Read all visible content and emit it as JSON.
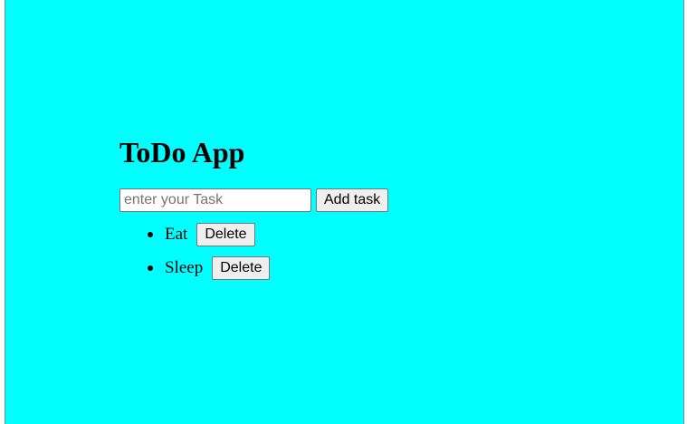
{
  "app": {
    "title": "ToDo App",
    "background_color": "#00ffff"
  },
  "form": {
    "input_value": "",
    "input_placeholder": "enter your Task",
    "add_button_label": "Add task"
  },
  "tasks": [
    {
      "text": "Eat",
      "delete_label": "Delete"
    },
    {
      "text": "Sleep",
      "delete_label": "Delete"
    }
  ]
}
